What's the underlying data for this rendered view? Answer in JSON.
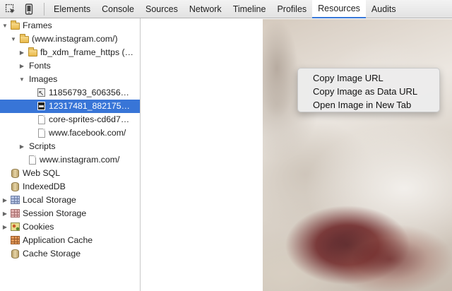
{
  "toolbar": {
    "icons": [
      "inspect-icon",
      "device-mode-icon"
    ],
    "tabs": [
      {
        "label": "Elements",
        "active": false
      },
      {
        "label": "Console",
        "active": false
      },
      {
        "label": "Sources",
        "active": false
      },
      {
        "label": "Network",
        "active": false
      },
      {
        "label": "Timeline",
        "active": false
      },
      {
        "label": "Profiles",
        "active": false
      },
      {
        "label": "Resources",
        "active": true
      },
      {
        "label": "Audits",
        "active": false
      }
    ],
    "accent_color": "#3879d9"
  },
  "sidebar": {
    "selected_color": "#3875d7",
    "items": [
      {
        "label": "Frames",
        "icon": "folder-icon",
        "expanded": true
      },
      {
        "label": "(www.instagram.com/)",
        "icon": "folder-icon",
        "expanded": true
      },
      {
        "label": "fb_xdm_frame_https (…",
        "icon": "folder-icon",
        "expanded": false
      },
      {
        "label": "Fonts",
        "expanded": false
      },
      {
        "label": "Images",
        "expanded": true
      },
      {
        "label": "11856793_606356…",
        "icon": "image-file-icon"
      },
      {
        "label": "12317481_882175…",
        "icon": "image-file-icon",
        "selected": true
      },
      {
        "label": "core-sprites-cd6d7…",
        "icon": "file-icon"
      },
      {
        "label": "www.facebook.com/",
        "icon": "file-icon"
      },
      {
        "label": "Scripts",
        "expanded": false
      },
      {
        "label": "www.instagram.com/",
        "icon": "file-icon"
      },
      {
        "label": "Web SQL",
        "icon": "database-icon"
      },
      {
        "label": "IndexedDB",
        "icon": "database-icon"
      },
      {
        "label": "Local Storage",
        "icon": "grid-storage-icon",
        "expanded": false
      },
      {
        "label": "Session Storage",
        "icon": "grid-storage-icon",
        "expanded": false
      },
      {
        "label": "Cookies",
        "icon": "cookie-icon",
        "expanded": false
      },
      {
        "label": "Application Cache",
        "icon": "grid-storage-icon"
      },
      {
        "label": "Cache Storage",
        "icon": "database-icon"
      }
    ]
  },
  "context_menu": {
    "items": [
      {
        "label": "Copy Image URL"
      },
      {
        "label": "Copy Image as Data URL"
      },
      {
        "label": "Open Image in New Tab"
      }
    ]
  }
}
